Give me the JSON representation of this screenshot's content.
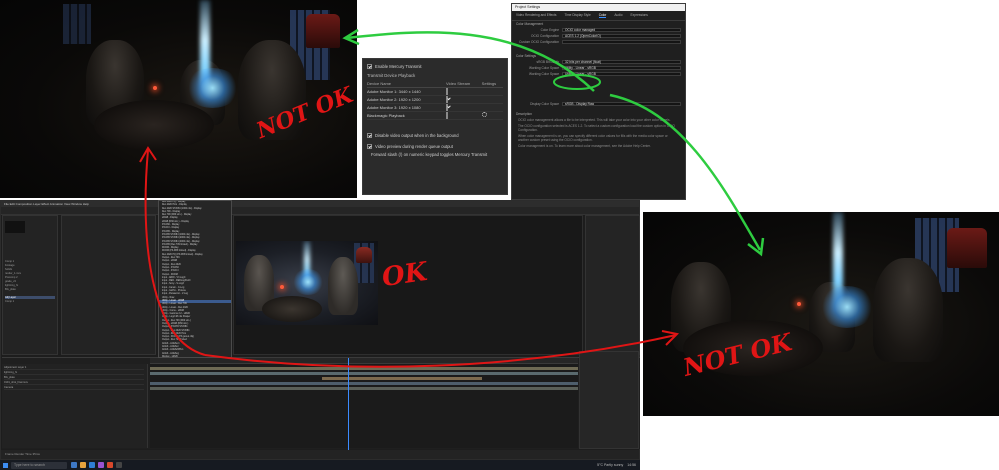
{
  "annotations": {
    "top_left_label": "NOT OK",
    "middle_label": "OK",
    "right_label": "NOT OK",
    "colors": {
      "red": "#e01515",
      "green": "#2ecc40"
    }
  },
  "mercury_transmit": {
    "enable_label": "Enable Mercury Transmit",
    "device_section": "Transmit Device Playback",
    "columns": [
      "Device Name",
      "Video Stream",
      "Settings"
    ],
    "devices": [
      {
        "name": "Adobe Monitor 1: 3440 x 1440",
        "enabled": false
      },
      {
        "name": "Adobe Monitor 2: 1920 x 1200",
        "enabled": true
      },
      {
        "name": "Adobe Monitor 3: 1920 x 1080",
        "enabled": true
      },
      {
        "name": "Blackmagic Playback",
        "enabled": false
      }
    ],
    "option_disable_bg": "Disable video output when in the background",
    "option_render_queue": "Video preview during render queue output",
    "footer_note": "Forward slash (/) on numeric keypad toggles Mercury Transmit"
  },
  "project_settings": {
    "window_title": "Project Settings",
    "tabs": [
      "Video Rendering and Effects",
      "Time Display Style",
      "Color",
      "Audio",
      "Expressions"
    ],
    "active_tab": "Color",
    "color_management_label": "Color Management",
    "fields": [
      {
        "label": "Color Engine",
        "value": "OCIO color managed"
      },
      {
        "label": "OCIO Configuration",
        "value": "ACES 1.2 (OpenColorIO)"
      },
      {
        "label": "Custom OCIO Configuration",
        "value": ""
      }
    ],
    "color_settings_label": "Color Settings",
    "settings": [
      {
        "label": "sRGB Bit Depth",
        "value": "32 bits per channel (float)"
      },
      {
        "label": "Working Color Space",
        "value": "Utility - Linear - sRGB"
      },
      {
        "label": "Working Color Space",
        "value": "Utility - Linear - sRGB"
      }
    ],
    "display_label": "Display Color Space",
    "display_value": "sRGB - Display Raw",
    "description_title": "Description",
    "description_lines": [
      "OCIO color management allows a file to be interpreted. This will take your color into your other color wheels.",
      "The OCIO configuration selected is ACES 1.2. To select a custom configuration load the custom option in OCIO Configuration.",
      "When color management is on, you can specify different color values for fills with the media color space or another custom preset using the OCIO configuration.",
      "Color management is on. To learn more about color management, see the Adobe Help Center."
    ]
  },
  "after_effects": {
    "menu": "File  Edit  Composition  Layer  Effect  Animation  View  Window  Help",
    "project_items": [
      "Comp 1",
      "Footage",
      "Solids",
      "render_1.mov",
      "Precomp 2",
      "grade_v3",
      "lightning_fx",
      "BG_plate",
      "Adj Layer",
      "Comp 1"
    ],
    "layers": [
      "Adjustment Layer 1",
      "lightning_fx",
      "BG_plate",
      "0101_shot_final.mov",
      "Camera"
    ],
    "status": "Frame Render Time 35ms"
  },
  "view_dropdown": {
    "options": [
      "Rec.2020 PQ - Display",
      "Rec.2020 HLG - Display",
      "Rec.2020 ST2084 (1000 nits) - Display",
      "Rec.709 - Display",
      "Rec.709 (D60 sim.) - Display",
      "sRGB - Display",
      "sRGB (D60 sim.) - Display",
      "P3-D60 - Display",
      "P3-DCI - Display",
      "P3-D65 - Display",
      "P3-D65 ST2084 (1000 nits) - Display",
      "P3-D65 ST2084 (2000 nits) - Display",
      "P3-D65 ST2084 (4000 nits) - Display",
      "P3-D65 (Rec.709 limited) - Display",
      "DCDM - Display",
      "DCDM (P3-D65 limited) - Display",
      "Rec.2020 PQ (P3-D65 limited) - Display",
      "Output - Rec.709",
      "Output - sRGB",
      "Output - Rec.2020",
      "Output - P3-D60",
      "Output - P3-DCI",
      "Output - DCDM",
      "Input - ARRI - V3 LogC",
      "Input - RED - REDLog3G10",
      "Input - Sony - S-Log3",
      "Input - Canon - C-Log",
      "Input - GoPro - Protune",
      "Input - Panasonic - V-Log",
      "Utility - Raw",
      "Utility - Linear - sRGB",
      "Utility - Linear - Rec.709",
      "Utility - Linear - Rec.2020",
      "Utility - Curve - sRGB",
      "Utility - Gamma 2.2 - sRGB",
      "Utility - Log2 48 nits Shaper",
      "Output - Rec.709 (D60 sim.)",
      "Output - sRGB (D60 sim.)",
      "Output - P3-D65 ST2084",
      "Output - Rec.2020 ST2084",
      "Output - Rec.2020 HLG",
      "Output - DCDM (P3 gamut clip)",
      "Output - Rec.709 limited",
      "ACES - ACEScct",
      "ACES - ACEScc",
      "ACES - ACES2065-1",
      "ACES - ACEScg",
      "Display - sRGB",
      "Display - Rec.709"
    ],
    "highlighted_index": 30
  },
  "taskbar": {
    "search_placeholder": "Type here to search",
    "tray_text": "5°C  Partly sunny",
    "clock": "14:56"
  }
}
